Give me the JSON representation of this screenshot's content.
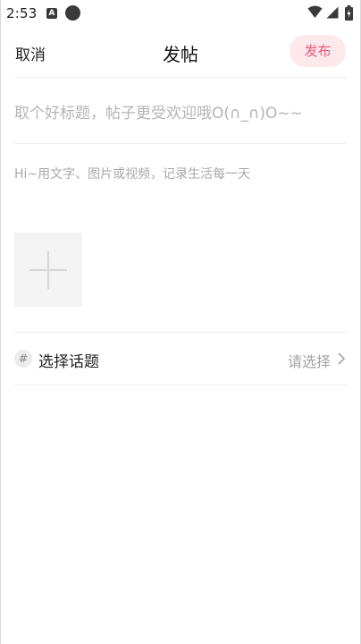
{
  "status_bar": {
    "time": "2:53",
    "badge": "A"
  },
  "header": {
    "cancel_label": "取消",
    "title": "发帖",
    "publish_label": "发布",
    "accent_color": "#e8577a",
    "accent_bg": "#fde8ec"
  },
  "form": {
    "title_placeholder": "取个好标题，帖子更受欢迎哦O(∩_∩)O~~",
    "body_placeholder": "Hi~用文字、图片或视频，记录生活每一天"
  },
  "topic": {
    "icon_glyph": "#",
    "label": "选择话题",
    "value_placeholder": "请选择"
  },
  "icons": [
    "wifi-icon",
    "signal-icon",
    "battery-icon",
    "add-media-icon",
    "hash-icon",
    "chevron-right-icon"
  ]
}
